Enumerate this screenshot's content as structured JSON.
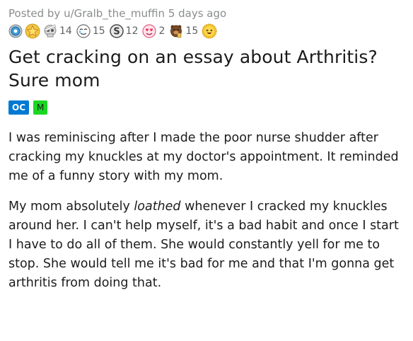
{
  "post": {
    "meta": "Posted by u/Gralb_the_muffin 5 days ago",
    "awards": [
      {
        "icon": "silver-coin-icon",
        "count": ""
      },
      {
        "icon": "gold-star-icon",
        "count": ""
      },
      {
        "icon": "skull-bandage-icon",
        "count": "14"
      },
      {
        "icon": "crying-face-icon",
        "count": "15"
      },
      {
        "icon": "s-coin-icon",
        "count": "12"
      },
      {
        "icon": "heart-eyes-icon",
        "count": "2"
      },
      {
        "icon": "bear-drink-icon",
        "count": "15"
      },
      {
        "icon": "laughing-sun-icon",
        "count": ""
      }
    ],
    "title": "Get cracking on an essay about Arthritis? Sure mom",
    "flairs": {
      "oc": "OC",
      "m": "M"
    },
    "body": {
      "p1": "I was reminiscing after I made the poor nurse shudder after cracking my knuckles at my doctor's appointment. It reminded me of a funny story with my mom.",
      "p2_before": "My mom absolutely ",
      "p2_italic": "loathed",
      "p2_after": " whenever I cracked my knuckles around her. I can't help myself, it's a bad habit and once I start I have to do all of them. She would constantly yell for me to stop. She would tell me it's bad for me and that I'm gonna get arthritis from doing that."
    }
  },
  "colors": {
    "meta_text": "#8a8c8e",
    "oc_flair_bg": "#0079d3",
    "m_flair_bg": "#1bd625"
  }
}
